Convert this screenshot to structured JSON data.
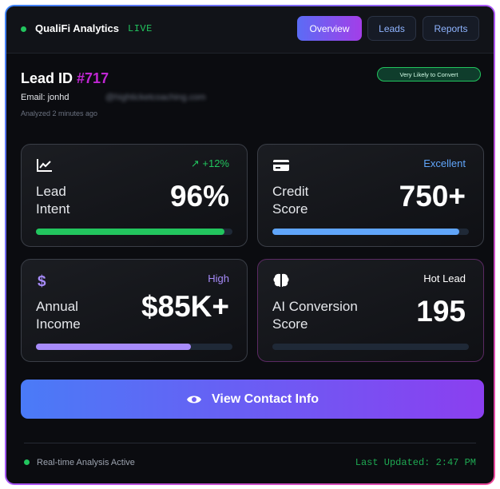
{
  "header": {
    "brand": "QualiFi Analytics",
    "live": "LIVE",
    "nav": [
      {
        "label": "Overview",
        "active": true
      },
      {
        "label": "Leads",
        "active": false
      },
      {
        "label": "Reports",
        "active": false
      }
    ]
  },
  "lead": {
    "id_label": "Lead ID",
    "id_value": "#717",
    "email_prefix": "Email: jonhd",
    "email_domain": "@highticketcoaching.com",
    "analyzed": "Analyzed 2 minutes ago",
    "badge": "Very Likely to Convert"
  },
  "cards": {
    "intent": {
      "label_line1": "Lead",
      "label_line2": "Intent",
      "value": "96%",
      "badge": "↗ +12%",
      "badge_color": "#22c55e",
      "bar_percent": 96,
      "bar_color": "#22c55e",
      "icon": "chart-line-icon"
    },
    "credit": {
      "label_line1": "Credit",
      "label_line2": "Score",
      "value": "750+",
      "badge": "Excellent",
      "badge_color": "#60a5fa",
      "bar_percent": 95,
      "bar_color": "#60a5fa",
      "icon": "credit-card-icon"
    },
    "income": {
      "label_line1": "Annual",
      "label_line2": "Income",
      "value": "$85K+",
      "badge": "High",
      "badge_color": "#a78bfa",
      "bar_percent": 79,
      "bar_color": "#a78bfa",
      "icon": "dollar-icon"
    },
    "ai": {
      "label_line1": "AI Conversion",
      "label_line2": "Score",
      "value": "195",
      "badge": "Hot Lead",
      "badge_color": "#ffffff",
      "bar_percent": 0,
      "bar_color": "#22c55e",
      "icon": "brain-icon"
    }
  },
  "cta": {
    "label": "View Contact Info",
    "icon": "eye-icon"
  },
  "footer": {
    "status": "Real-time Analysis Active",
    "updated": "Last Updated: 2:47 PM"
  },
  "colors": {
    "accent_green": "#22c55e",
    "lead_id": "#c026d3",
    "cta_start": "#4a7bf7",
    "cta_end": "#8b3ff0"
  }
}
